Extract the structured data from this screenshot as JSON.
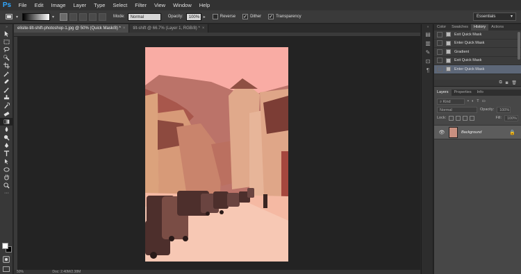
{
  "app": {
    "logo": "Ps"
  },
  "menu": [
    "File",
    "Edit",
    "Image",
    "Layer",
    "Type",
    "Select",
    "Filter",
    "View",
    "Window",
    "Help"
  ],
  "options": {
    "mode_label": "Mode:",
    "mode_value": "Normal",
    "opacity_label": "Opacity:",
    "opacity_value": "100%",
    "reverse_label": "Reverse",
    "dither_label": "Dither",
    "transparency_label": "Transparency",
    "reverse_checked": false,
    "dither_checked": true,
    "transparency_checked": true
  },
  "workspace": "Essentials",
  "tabs": [
    {
      "label": "elisite-tilt-shift-photoshop-1.jpg @ 50% (Quick Mask/8) *",
      "active": true
    },
    {
      "label": "tilt-shift @ 66.7% (Layer 1, RGB/8) *",
      "active": false
    }
  ],
  "status": {
    "zoom": "50%",
    "doc": "Doc: 2.40M/2.38M"
  },
  "panels": {
    "history_tabs": [
      "Color",
      "Swatches",
      "History",
      "Actions"
    ],
    "history_active": "History",
    "history": [
      {
        "label": "Exit Quick Mask",
        "selected": false
      },
      {
        "label": "Enter Quick Mask",
        "selected": false
      },
      {
        "label": "Gradient",
        "selected": false
      },
      {
        "label": "Exit Quick Mask",
        "selected": false
      },
      {
        "label": "Enter Quick Mask",
        "selected": true
      }
    ],
    "layers_tabs": [
      "Layers",
      "Properties",
      "Info"
    ],
    "layers_active": "Layers",
    "kind_label": "Kind",
    "blend_mode": "Normal",
    "opacity_label": "Opacity:",
    "opacity_value": "100%",
    "lock_label": "Lock:",
    "fill_label": "Fill:",
    "fill_value": "100%",
    "layers": [
      {
        "name": "Background",
        "visible": true,
        "locked": true
      }
    ]
  },
  "colors": {
    "quick_mask_overlay": "#ff4d3d",
    "history_selected": "#5d6778",
    "brand": "#31a8ff"
  }
}
